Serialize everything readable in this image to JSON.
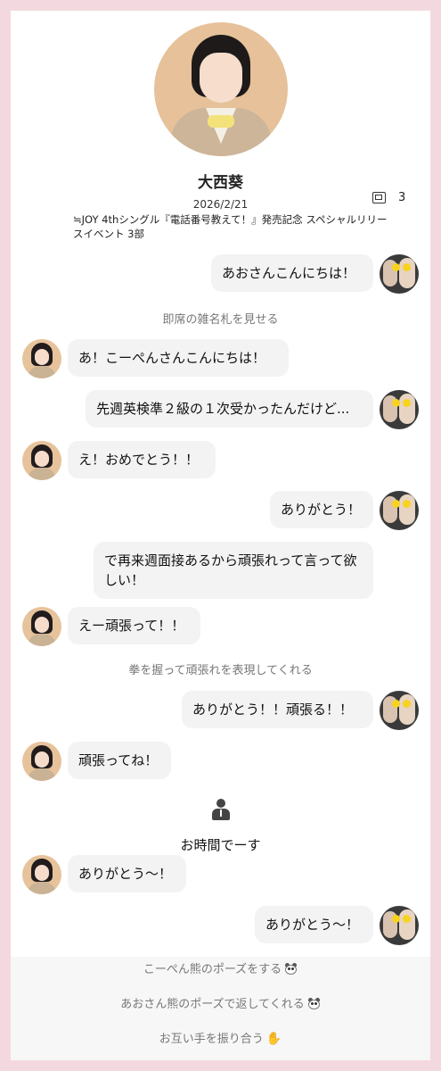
{
  "profile": {
    "name": "大西葵",
    "date": "2026/2/21",
    "count": "3",
    "event": "≒JOY 4thシングル『電話番号教えて！』発売記念 スペシャルリリースイベント 3部"
  },
  "messages": [
    {
      "from": "me",
      "text": "あおさんこんにちは！"
    },
    {
      "from": "note",
      "text": "即席の雑名札を見せる"
    },
    {
      "from": "her",
      "text": "あ！こーぺんさんこんにちは！"
    },
    {
      "from": "me",
      "text": "先週英検準２級の１次受かったんだけど..."
    },
    {
      "from": "her",
      "text": "え！おめでとう！！"
    },
    {
      "from": "me",
      "text": "ありがとう！"
    },
    {
      "from": "me",
      "text": "で再来週面接あるから頑張れって言って欲しい！"
    },
    {
      "from": "her",
      "text": "えー頑張って！！"
    },
    {
      "from": "note",
      "text": "拳を握って頑張れを表現してくれる"
    },
    {
      "from": "me",
      "text": "ありがとう！！頑張る！！"
    },
    {
      "from": "her",
      "text": "頑張ってね！"
    },
    {
      "from": "end",
      "text": "お時間でーす"
    },
    {
      "from": "her",
      "text": "ありがとう〜！"
    },
    {
      "from": "me",
      "text": "ありがとう〜！"
    }
  ],
  "footer": {
    "note1": "こーぺん熊のポーズをする",
    "note2": "あおさん熊のポーズで返してくれる",
    "note3": "お互い手を振り合う"
  },
  "icons": [
    "ticket-icon",
    "person-icon",
    "bear-emoji-icon",
    "waving-hand-icon"
  ]
}
